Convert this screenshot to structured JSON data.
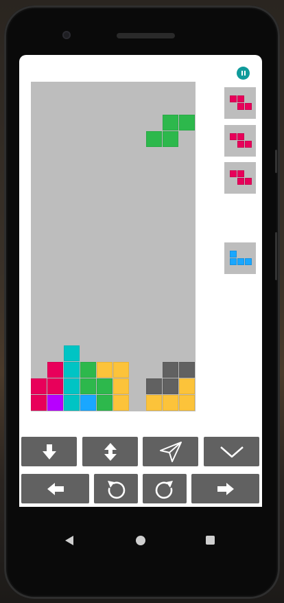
{
  "colors": {
    "well_bg": "#bdbdbd",
    "accent": "#0f9b9b",
    "control_bg": "#616161",
    "pink": "#e8005a",
    "green": "#2db84c",
    "cyan": "#00c4c4",
    "yellow": "#fcc33a",
    "purple": "#b700ff",
    "blue": "#1aa7ff",
    "gray": "#616161"
  },
  "board": {
    "columns": 10,
    "rows": 20,
    "active_piece": {
      "type": "S",
      "color": "green",
      "cells": [
        [
          8,
          2
        ],
        [
          9,
          2
        ],
        [
          7,
          3
        ],
        [
          8,
          3
        ]
      ]
    },
    "locked_cells": [
      {
        "col": 2,
        "row": 16,
        "color": "cyan"
      },
      {
        "col": 1,
        "row": 17,
        "color": "pink"
      },
      {
        "col": 2,
        "row": 17,
        "color": "cyan"
      },
      {
        "col": 3,
        "row": 17,
        "color": "green"
      },
      {
        "col": 4,
        "row": 17,
        "color": "yellow"
      },
      {
        "col": 5,
        "row": 17,
        "color": "yellow"
      },
      {
        "col": 8,
        "row": 17,
        "color": "gray"
      },
      {
        "col": 9,
        "row": 17,
        "color": "gray"
      },
      {
        "col": 0,
        "row": 18,
        "color": "pink"
      },
      {
        "col": 1,
        "row": 18,
        "color": "pink"
      },
      {
        "col": 2,
        "row": 18,
        "color": "cyan"
      },
      {
        "col": 3,
        "row": 18,
        "color": "green"
      },
      {
        "col": 4,
        "row": 18,
        "color": "green"
      },
      {
        "col": 5,
        "row": 18,
        "color": "yellow"
      },
      {
        "col": 7,
        "row": 18,
        "color": "gray"
      },
      {
        "col": 8,
        "row": 18,
        "color": "gray"
      },
      {
        "col": 9,
        "row": 18,
        "color": "yellow"
      },
      {
        "col": 0,
        "row": 19,
        "color": "pink"
      },
      {
        "col": 1,
        "row": 19,
        "color": "purple"
      },
      {
        "col": 2,
        "row": 19,
        "color": "cyan"
      },
      {
        "col": 3,
        "row": 19,
        "color": "blue"
      },
      {
        "col": 4,
        "row": 19,
        "color": "green"
      },
      {
        "col": 5,
        "row": 19,
        "color": "yellow"
      },
      {
        "col": 7,
        "row": 19,
        "color": "yellow"
      },
      {
        "col": 8,
        "row": 19,
        "color": "yellow"
      },
      {
        "col": 9,
        "row": 19,
        "color": "yellow"
      }
    ]
  },
  "next_queue": [
    {
      "type": "Z",
      "color": "pink",
      "cells": [
        [
          0,
          0
        ],
        [
          1,
          0
        ],
        [
          1,
          1
        ],
        [
          2,
          1
        ]
      ]
    },
    {
      "type": "Z",
      "color": "pink",
      "cells": [
        [
          0,
          0
        ],
        [
          1,
          0
        ],
        [
          1,
          1
        ],
        [
          2,
          1
        ]
      ]
    },
    {
      "type": "Z",
      "color": "pink",
      "cells": [
        [
          0,
          0
        ],
        [
          1,
          0
        ],
        [
          1,
          1
        ],
        [
          2,
          1
        ]
      ]
    }
  ],
  "hold_piece": {
    "type": "J",
    "color": "blue",
    "cells": [
      [
        0,
        0
      ],
      [
        0,
        1
      ],
      [
        1,
        1
      ],
      [
        2,
        1
      ]
    ]
  },
  "controls": {
    "row1": [
      {
        "name": "soft-drop-button",
        "icon": "arrow-down-icon"
      },
      {
        "name": "swap-hold-button",
        "icon": "arrow-up-down-icon"
      },
      {
        "name": "hard-drop-button",
        "icon": "paper-plane-icon"
      },
      {
        "name": "collapse-button",
        "icon": "chevron-down-icon"
      }
    ],
    "row2": [
      {
        "name": "move-left-button",
        "icon": "arrow-left-icon"
      },
      {
        "name": "rotate-ccw-button",
        "icon": "rotate-ccw-icon"
      },
      {
        "name": "rotate-cw-button",
        "icon": "rotate-cw-icon"
      },
      {
        "name": "move-right-button",
        "icon": "arrow-right-icon"
      }
    ]
  },
  "system_nav": [
    "back-icon",
    "home-icon",
    "recent-apps-icon"
  ]
}
